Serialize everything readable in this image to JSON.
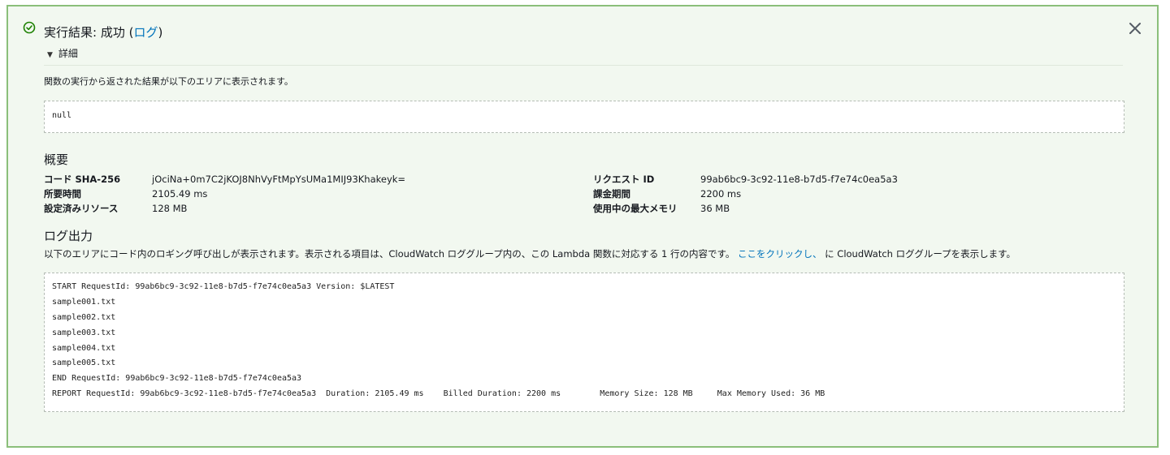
{
  "result": {
    "title_prefix": "実行結果: 成功 (",
    "log_link": "ログ",
    "title_suffix": ")",
    "details_label": "詳細",
    "description": "関数の実行から返された結果が以下のエリアに表示されます。",
    "value": "null"
  },
  "summary": {
    "heading": "概要",
    "left": [
      {
        "label": "コード SHA-256",
        "value": "jOciNa+0m7C2jKOJ8NhVyFtMpYsUMa1MIJ93Khakeyk="
      },
      {
        "label": "所要時間",
        "value": "2105.49 ms"
      },
      {
        "label": "設定済みリソース",
        "value": "128 MB"
      }
    ],
    "right": [
      {
        "label": "リクエスト ID",
        "value": "99ab6bc9-3c92-11e8-b7d5-f7e74c0ea5a3"
      },
      {
        "label": "課金期間",
        "value": "2200 ms"
      },
      {
        "label": "使用中の最大メモリ",
        "value": "36 MB"
      }
    ]
  },
  "log": {
    "heading": "ログ出力",
    "desc_before": "以下のエリアにコード内のロギング呼び出しが表示されます。表示される項目は、CloudWatch ロググループ内の、この Lambda 関数に対応する 1 行の内容です。",
    "desc_link": "ここをクリックし、",
    "desc_after": " に CloudWatch ロググループを表示します。",
    "lines": [
      "START RequestId: 99ab6bc9-3c92-11e8-b7d5-f7e74c0ea5a3 Version: $LATEST",
      "sample001.txt",
      "sample002.txt",
      "sample003.txt",
      "sample004.txt",
      "sample005.txt",
      "END RequestId: 99ab6bc9-3c92-11e8-b7d5-f7e74c0ea5a3",
      "REPORT RequestId: 99ab6bc9-3c92-11e8-b7d5-f7e74c0ea5a3  Duration: 2105.49 ms    Billed Duration: 2200 ms        Memory Size: 128 MB     Max Memory Used: 36 MB"
    ]
  },
  "icons": {
    "status": "check-circle-icon",
    "close": "close-icon",
    "toggle": "caret-down-icon"
  },
  "colors": {
    "success": "#1d8102",
    "link": "#0073bb",
    "panel_bg": "#f2f8f0",
    "panel_border": "#8bbf7a"
  }
}
